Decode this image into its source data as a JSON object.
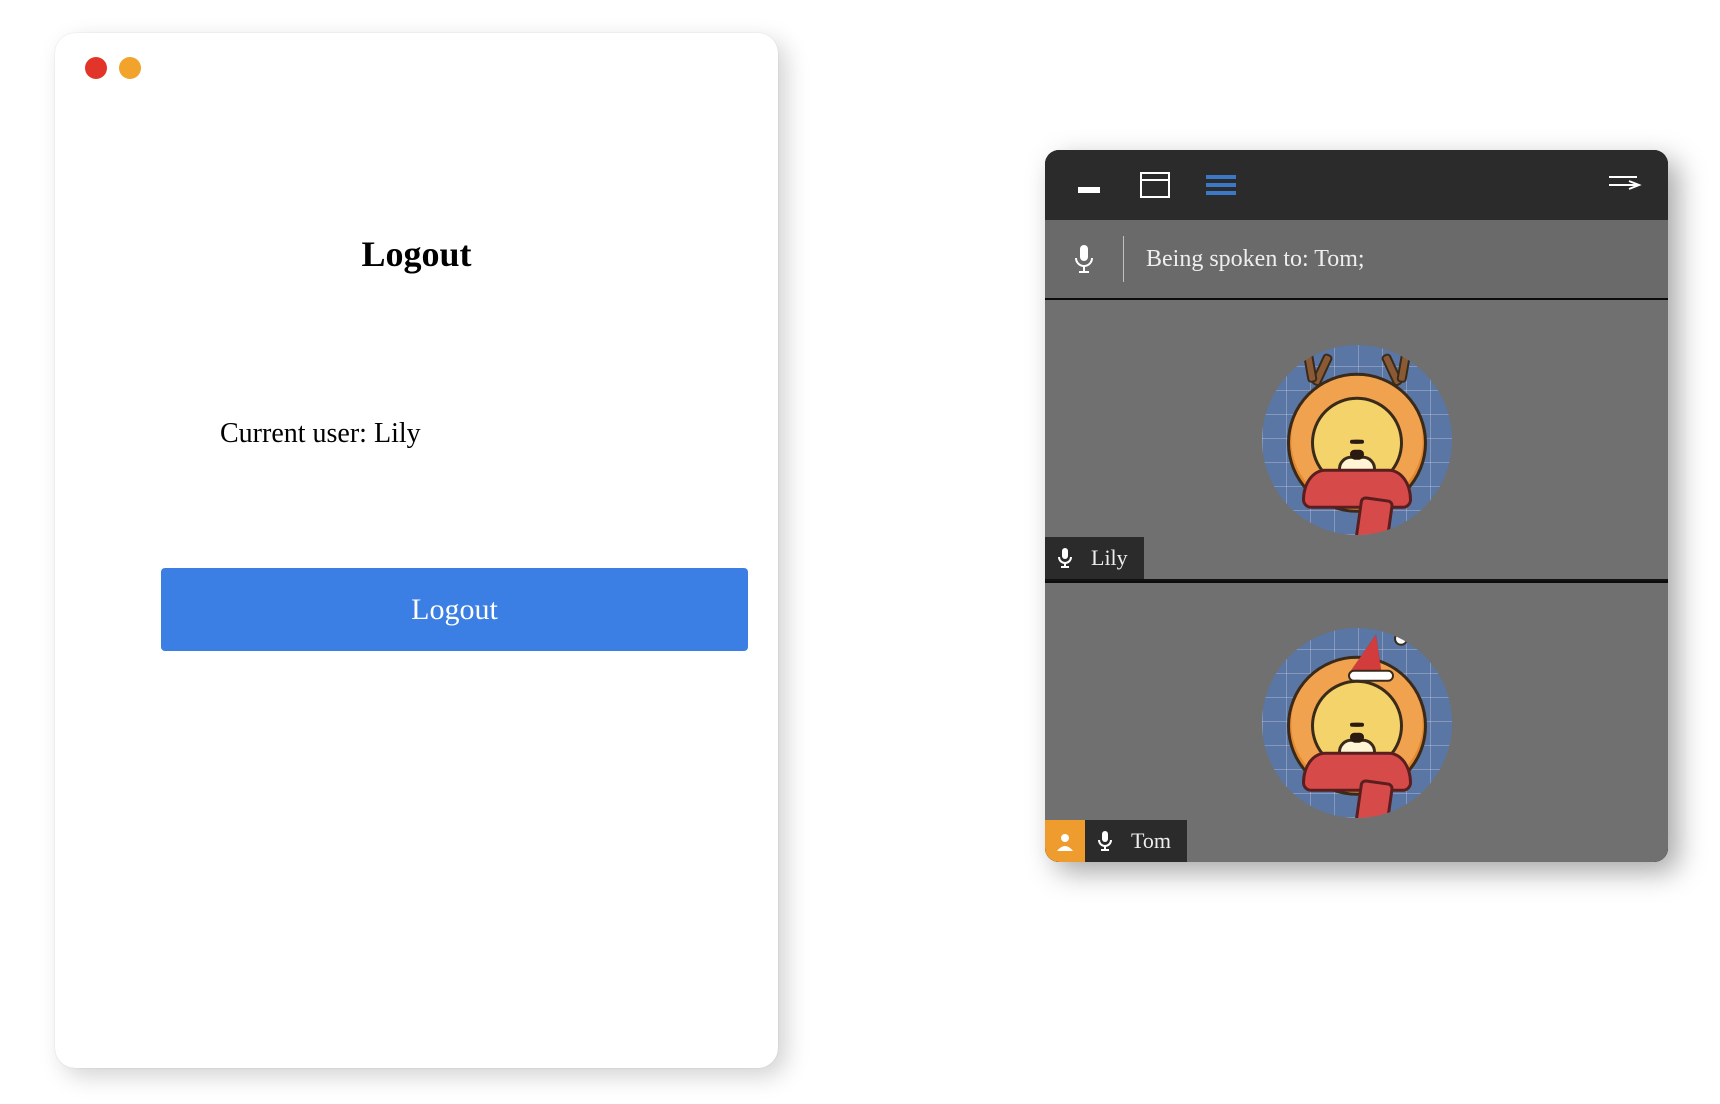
{
  "logout_window": {
    "title": "Logout",
    "current_user_label": "Current user: Lily",
    "button_label": "Logout",
    "traffic_lights": [
      "red",
      "orange"
    ]
  },
  "call_window": {
    "toolbar_icons": [
      "minimize",
      "window",
      "list",
      "collapse-right"
    ],
    "active_toolbar_icon": "list",
    "speaking_label": "Being spoken to: Tom;",
    "participants": [
      {
        "name": "Lily",
        "avatar_style": "antlers",
        "is_self": false
      },
      {
        "name": "Tom",
        "avatar_style": "santa_hat",
        "is_self": true
      }
    ]
  },
  "colors": {
    "primary_button": "#3b7fe4",
    "toolbar_bg": "#2b2b2b",
    "panel_bg": "#6a6a6a",
    "self_badge": "#ef9c2f",
    "accent_blue": "#3c78c8"
  }
}
